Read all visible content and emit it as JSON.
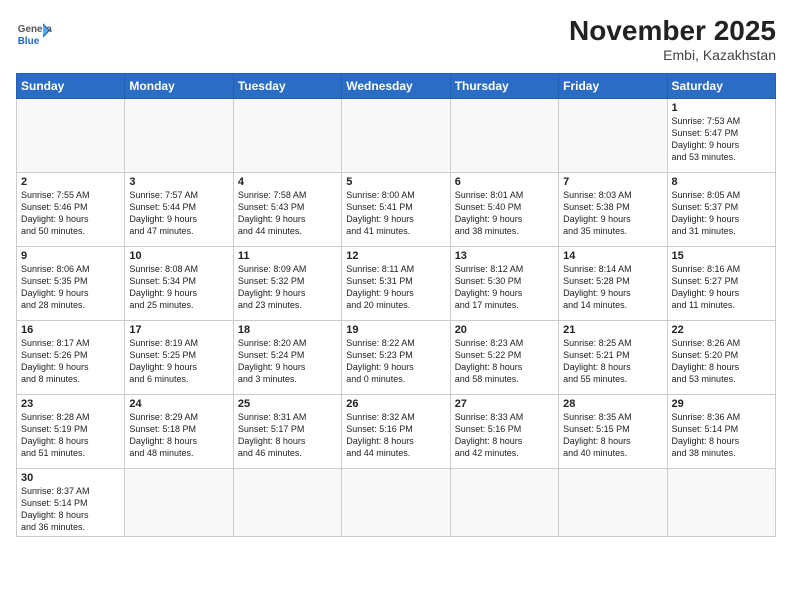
{
  "logo": {
    "line1": "General",
    "line2": "Blue"
  },
  "title": "November 2025",
  "location": "Embi, Kazakhstan",
  "weekdays": [
    "Sunday",
    "Monday",
    "Tuesday",
    "Wednesday",
    "Thursday",
    "Friday",
    "Saturday"
  ],
  "weeks": [
    [
      {
        "day": "",
        "info": ""
      },
      {
        "day": "",
        "info": ""
      },
      {
        "day": "",
        "info": ""
      },
      {
        "day": "",
        "info": ""
      },
      {
        "day": "",
        "info": ""
      },
      {
        "day": "",
        "info": ""
      },
      {
        "day": "1",
        "info": "Sunrise: 7:53 AM\nSunset: 5:47 PM\nDaylight: 9 hours\nand 53 minutes."
      }
    ],
    [
      {
        "day": "2",
        "info": "Sunrise: 7:55 AM\nSunset: 5:46 PM\nDaylight: 9 hours\nand 50 minutes."
      },
      {
        "day": "3",
        "info": "Sunrise: 7:57 AM\nSunset: 5:44 PM\nDaylight: 9 hours\nand 47 minutes."
      },
      {
        "day": "4",
        "info": "Sunrise: 7:58 AM\nSunset: 5:43 PM\nDaylight: 9 hours\nand 44 minutes."
      },
      {
        "day": "5",
        "info": "Sunrise: 8:00 AM\nSunset: 5:41 PM\nDaylight: 9 hours\nand 41 minutes."
      },
      {
        "day": "6",
        "info": "Sunrise: 8:01 AM\nSunset: 5:40 PM\nDaylight: 9 hours\nand 38 minutes."
      },
      {
        "day": "7",
        "info": "Sunrise: 8:03 AM\nSunset: 5:38 PM\nDaylight: 9 hours\nand 35 minutes."
      },
      {
        "day": "8",
        "info": "Sunrise: 8:05 AM\nSunset: 5:37 PM\nDaylight: 9 hours\nand 31 minutes."
      }
    ],
    [
      {
        "day": "9",
        "info": "Sunrise: 8:06 AM\nSunset: 5:35 PM\nDaylight: 9 hours\nand 28 minutes."
      },
      {
        "day": "10",
        "info": "Sunrise: 8:08 AM\nSunset: 5:34 PM\nDaylight: 9 hours\nand 25 minutes."
      },
      {
        "day": "11",
        "info": "Sunrise: 8:09 AM\nSunset: 5:32 PM\nDaylight: 9 hours\nand 23 minutes."
      },
      {
        "day": "12",
        "info": "Sunrise: 8:11 AM\nSunset: 5:31 PM\nDaylight: 9 hours\nand 20 minutes."
      },
      {
        "day": "13",
        "info": "Sunrise: 8:12 AM\nSunset: 5:30 PM\nDaylight: 9 hours\nand 17 minutes."
      },
      {
        "day": "14",
        "info": "Sunrise: 8:14 AM\nSunset: 5:28 PM\nDaylight: 9 hours\nand 14 minutes."
      },
      {
        "day": "15",
        "info": "Sunrise: 8:16 AM\nSunset: 5:27 PM\nDaylight: 9 hours\nand 11 minutes."
      }
    ],
    [
      {
        "day": "16",
        "info": "Sunrise: 8:17 AM\nSunset: 5:26 PM\nDaylight: 9 hours\nand 8 minutes."
      },
      {
        "day": "17",
        "info": "Sunrise: 8:19 AM\nSunset: 5:25 PM\nDaylight: 9 hours\nand 6 minutes."
      },
      {
        "day": "18",
        "info": "Sunrise: 8:20 AM\nSunset: 5:24 PM\nDaylight: 9 hours\nand 3 minutes."
      },
      {
        "day": "19",
        "info": "Sunrise: 8:22 AM\nSunset: 5:23 PM\nDaylight: 9 hours\nand 0 minutes."
      },
      {
        "day": "20",
        "info": "Sunrise: 8:23 AM\nSunset: 5:22 PM\nDaylight: 8 hours\nand 58 minutes."
      },
      {
        "day": "21",
        "info": "Sunrise: 8:25 AM\nSunset: 5:21 PM\nDaylight: 8 hours\nand 55 minutes."
      },
      {
        "day": "22",
        "info": "Sunrise: 8:26 AM\nSunset: 5:20 PM\nDaylight: 8 hours\nand 53 minutes."
      }
    ],
    [
      {
        "day": "23",
        "info": "Sunrise: 8:28 AM\nSunset: 5:19 PM\nDaylight: 8 hours\nand 51 minutes."
      },
      {
        "day": "24",
        "info": "Sunrise: 8:29 AM\nSunset: 5:18 PM\nDaylight: 8 hours\nand 48 minutes."
      },
      {
        "day": "25",
        "info": "Sunrise: 8:31 AM\nSunset: 5:17 PM\nDaylight: 8 hours\nand 46 minutes."
      },
      {
        "day": "26",
        "info": "Sunrise: 8:32 AM\nSunset: 5:16 PM\nDaylight: 8 hours\nand 44 minutes."
      },
      {
        "day": "27",
        "info": "Sunrise: 8:33 AM\nSunset: 5:16 PM\nDaylight: 8 hours\nand 42 minutes."
      },
      {
        "day": "28",
        "info": "Sunrise: 8:35 AM\nSunset: 5:15 PM\nDaylight: 8 hours\nand 40 minutes."
      },
      {
        "day": "29",
        "info": "Sunrise: 8:36 AM\nSunset: 5:14 PM\nDaylight: 8 hours\nand 38 minutes."
      }
    ],
    [
      {
        "day": "30",
        "info": "Sunrise: 8:37 AM\nSunset: 5:14 PM\nDaylight: 8 hours\nand 36 minutes."
      },
      {
        "day": "",
        "info": ""
      },
      {
        "day": "",
        "info": ""
      },
      {
        "day": "",
        "info": ""
      },
      {
        "day": "",
        "info": ""
      },
      {
        "day": "",
        "info": ""
      },
      {
        "day": "",
        "info": ""
      }
    ]
  ]
}
